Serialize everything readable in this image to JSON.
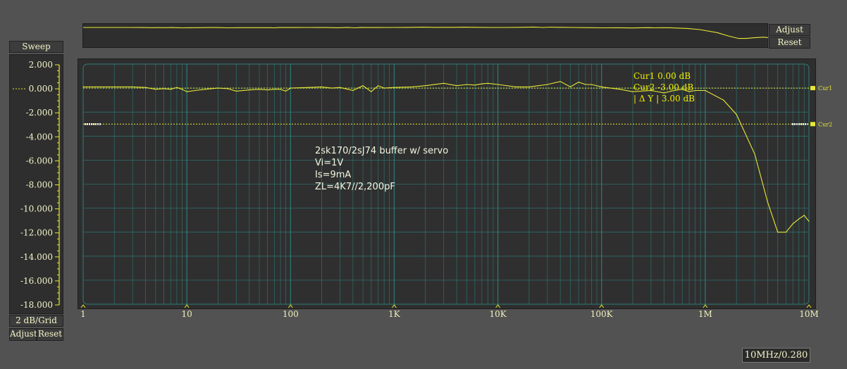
{
  "chart_data": {
    "type": "line",
    "xscale": "log",
    "xlim": [
      1,
      10000000
    ],
    "ylim": [
      -18,
      2
    ],
    "ylabel_ticks": [
      "2.000",
      "0.000",
      "-2.000",
      "-4.000",
      "-6.000",
      "-8.000",
      "-10.000",
      "-12.000",
      "-14.000",
      "-16.000",
      "-18.000"
    ],
    "xtick_labels": [
      {
        "v": 1,
        "label": "1"
      },
      {
        "v": 10,
        "label": "10"
      },
      {
        "v": 100,
        "label": "100"
      },
      {
        "v": 1000,
        "label": "1K"
      },
      {
        "v": 10000,
        "label": "10K"
      },
      {
        "v": 100000,
        "label": "100K"
      },
      {
        "v": 1000000,
        "label": "1M"
      },
      {
        "v": 10000000,
        "label": "10M"
      }
    ],
    "grid": true,
    "series": [
      {
        "color": "#e8e836",
        "x": [
          1,
          2,
          3,
          4,
          5,
          6,
          7,
          8,
          9,
          10,
          12,
          15,
          20,
          25,
          30,
          40,
          50,
          60,
          70,
          80,
          90,
          100,
          150,
          200,
          250,
          300,
          400,
          500,
          600,
          700,
          800,
          1000,
          1500,
          2000,
          3000,
          4000,
          5000,
          6000,
          7000,
          8000,
          10000,
          15000,
          20000,
          30000,
          40000,
          50000,
          60000,
          70000,
          80000,
          100000,
          150000,
          200000,
          300000,
          400000,
          500000,
          600000,
          700000,
          800000,
          1000000,
          1500000,
          2000000,
          3000000,
          4000000,
          5000000,
          6000000,
          7000000,
          8000000,
          9000000,
          10000000
        ],
        "y": [
          0.1,
          0.1,
          0.1,
          0.05,
          -0.1,
          -0.05,
          -0.1,
          0.05,
          -0.1,
          -0.3,
          -0.2,
          -0.1,
          0.0,
          -0.05,
          -0.25,
          -0.15,
          -0.1,
          -0.15,
          -0.1,
          -0.1,
          -0.25,
          0.0,
          0.05,
          0.1,
          0.0,
          0.05,
          -0.2,
          0.2,
          -0.3,
          0.2,
          0.0,
          0.05,
          0.1,
          0.2,
          0.4,
          0.2,
          0.3,
          0.25,
          0.35,
          0.4,
          0.3,
          0.1,
          0.1,
          0.3,
          0.55,
          0.1,
          0.5,
          0.3,
          0.3,
          0.1,
          -0.1,
          -0.3,
          -0.2,
          -0.4,
          -0.2,
          -0.1,
          -0.3,
          -0.2,
          -0.2,
          -1.0,
          -2.2,
          -5.5,
          -9.5,
          -12.0,
          -12.0,
          -11.3,
          -10.9,
          -10.6,
          -11.1
        ]
      }
    ],
    "cursors": [
      {
        "name": "Cur1",
        "value": 0.0,
        "tag": "Cur1"
      },
      {
        "name": "Cur2",
        "value": -3.0,
        "tag": "Cur2"
      }
    ],
    "annotations": {
      "cursor_readout": [
        "Cur1  0.00 dB",
        "Cur2  -3.00 dB",
        "|  Δ  Y  |   3.00 dB"
      ],
      "notes": [
        "2sk170/2sJ74 buffer w/ servo",
        "Vi=1V",
        "Is=9mA",
        "ZL=4K7//2,200pF"
      ]
    },
    "colors": {
      "trace": "#e8e836",
      "grid": "#2d7f7a",
      "axis": "#e8e836",
      "plot_bg": "#2f2f2f"
    }
  },
  "ui": {
    "sweep_label": "Sweep",
    "grid_label": "2 dB/Grid",
    "y_adjust": "Adjust",
    "y_reset": "Reset",
    "top_adjust": "Adjust",
    "top_reset": "Reset",
    "status": "10MHz/0.280"
  }
}
